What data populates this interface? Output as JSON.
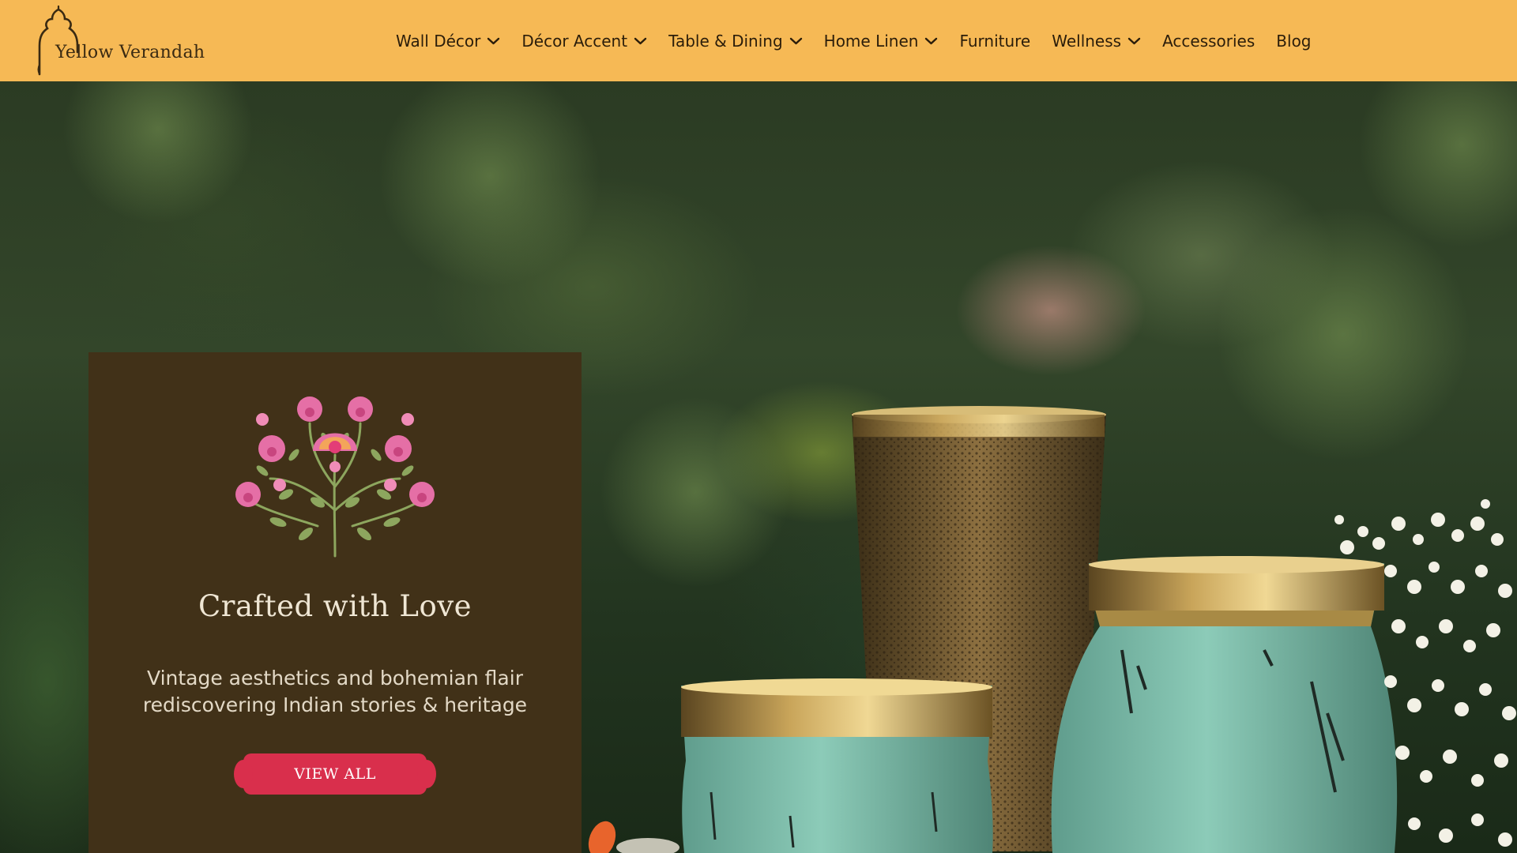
{
  "brand": {
    "name": "Yellow Verandah",
    "logo_icon": "arch-dome-icon"
  },
  "colors": {
    "header_bg": "#f6b955",
    "card_bg": "#413118",
    "button_bg": "#d92f4c",
    "nav_text": "#2b1d0a"
  },
  "nav": {
    "items": [
      {
        "label": "Wall Décor",
        "has_dropdown": true
      },
      {
        "label": "Décor Accent",
        "has_dropdown": true
      },
      {
        "label": "Table & Dining",
        "has_dropdown": true
      },
      {
        "label": "Home Linen",
        "has_dropdown": true
      },
      {
        "label": "Furniture",
        "has_dropdown": false
      },
      {
        "label": "Wellness",
        "has_dropdown": true
      },
      {
        "label": "Accessories",
        "has_dropdown": false
      },
      {
        "label": "Blog",
        "has_dropdown": false
      }
    ]
  },
  "hero": {
    "title": "Crafted with Love",
    "subtitle_line1": "Vintage aesthetics and bohemian flair",
    "subtitle_line2": "rediscovering Indian stories & heritage",
    "button_label": "VIEW ALL",
    "motif_icon": "floral-motif-icon"
  }
}
